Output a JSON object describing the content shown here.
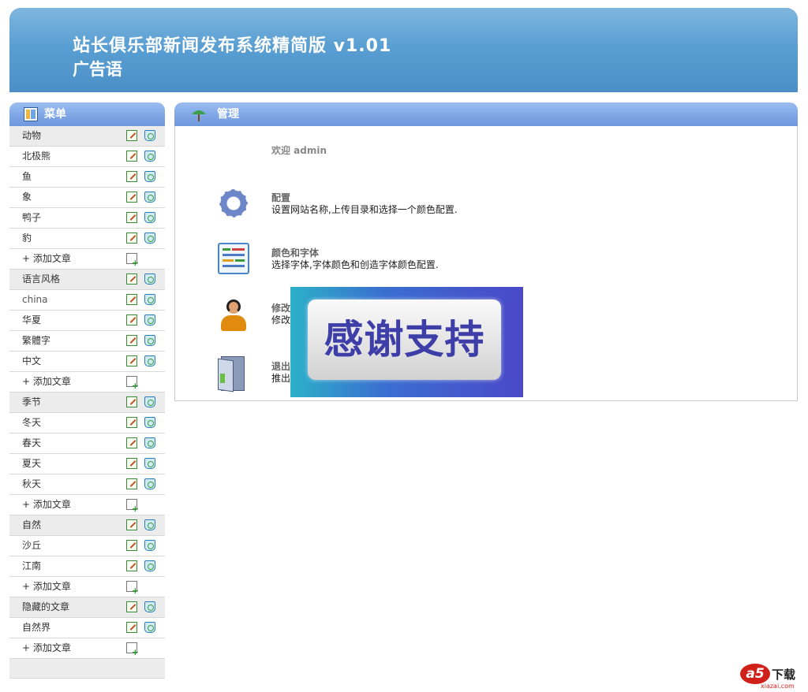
{
  "header": {
    "title": "站长俱乐部新闻发布系统精简版  v1.01",
    "slogan": "广告语"
  },
  "sidebar": {
    "title": "菜单",
    "rows": [
      {
        "label": "动物",
        "kind": "category"
      },
      {
        "label": "北极熊",
        "kind": "item"
      },
      {
        "label": "鱼",
        "kind": "item"
      },
      {
        "label": "象",
        "kind": "item"
      },
      {
        "label": "鸭子",
        "kind": "item"
      },
      {
        "label": "豹",
        "kind": "item"
      },
      {
        "label": "+ 添加文章",
        "kind": "add"
      },
      {
        "label": "语言风格",
        "kind": "category"
      },
      {
        "label": "china",
        "kind": "item"
      },
      {
        "label": "华夏",
        "kind": "item"
      },
      {
        "label": "繁體字",
        "kind": "item"
      },
      {
        "label": "中文",
        "kind": "item"
      },
      {
        "label": "+ 添加文章",
        "kind": "add"
      },
      {
        "label": "季节",
        "kind": "category"
      },
      {
        "label": "冬天",
        "kind": "item"
      },
      {
        "label": "春天",
        "kind": "item"
      },
      {
        "label": "夏天",
        "kind": "item"
      },
      {
        "label": "秋天",
        "kind": "item"
      },
      {
        "label": "+ 添加文章",
        "kind": "add"
      },
      {
        "label": "自然",
        "kind": "category"
      },
      {
        "label": "沙丘",
        "kind": "item"
      },
      {
        "label": "江南",
        "kind": "item"
      },
      {
        "label": "+ 添加文章",
        "kind": "add"
      },
      {
        "label": "隐藏的文章",
        "kind": "category"
      },
      {
        "label": "自然界",
        "kind": "item"
      },
      {
        "label": "+ 添加文章",
        "kind": "add"
      }
    ]
  },
  "main": {
    "title": "管理",
    "welcome": "欢迎 admin",
    "items": [
      {
        "icon": "gear-icon",
        "title": "配置",
        "desc": "设置网站名称,上传目录和选择一个颜色配置."
      },
      {
        "icon": "layout-icon",
        "title": "颜色和字体",
        "desc": "选择字体,字体颜色和创造字体颜色配置."
      },
      {
        "icon": "user-icon",
        "title": "修改密码",
        "desc": "修改密码"
      },
      {
        "icon": "exit-door-icon",
        "title": "退出",
        "desc": "推出"
      }
    ]
  },
  "overlay": {
    "text": "感谢支持"
  },
  "watermark": {
    "logo": "a5",
    "label": "下载",
    "url": "xiazai.com"
  }
}
